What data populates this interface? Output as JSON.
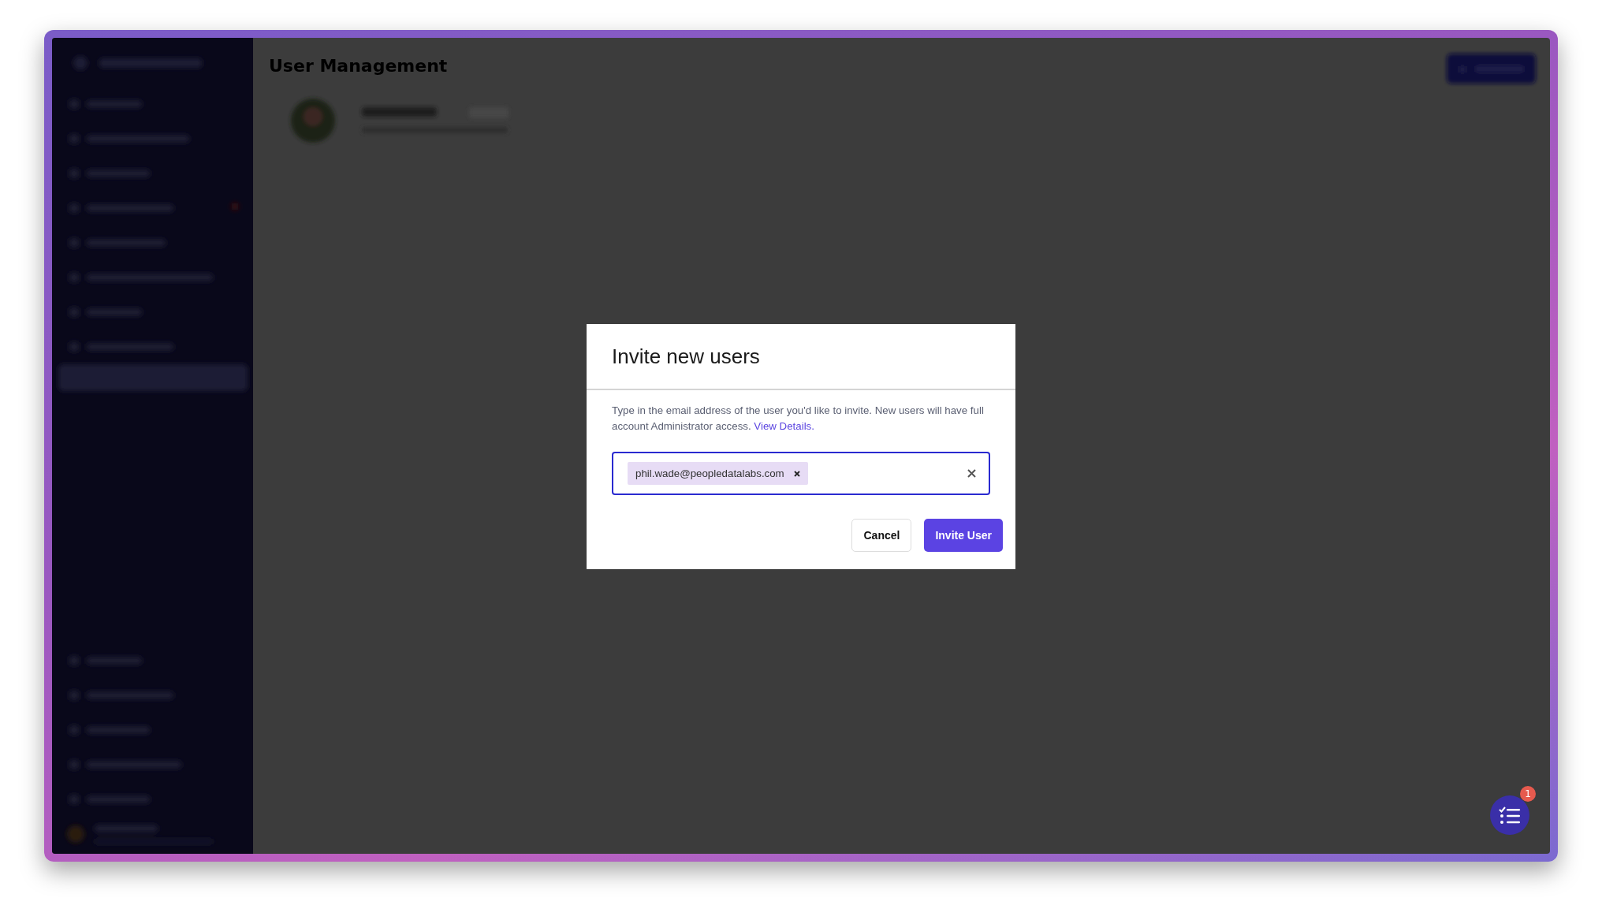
{
  "page": {
    "title": "User Management"
  },
  "dialog": {
    "title": "Invite new users",
    "description": "Type in the email address of the user you'd like to invite. New users will have full account Administrator access.",
    "link": "View Details.",
    "recipients": [
      {
        "email": "phil.wade@peopledatalabs.com"
      }
    ],
    "buttons": [
      {
        "label": "Cancel",
        "kind": "secondary"
      },
      {
        "label": "Invite User",
        "kind": "primary"
      }
    ]
  },
  "chat": {
    "badge": "1"
  }
}
